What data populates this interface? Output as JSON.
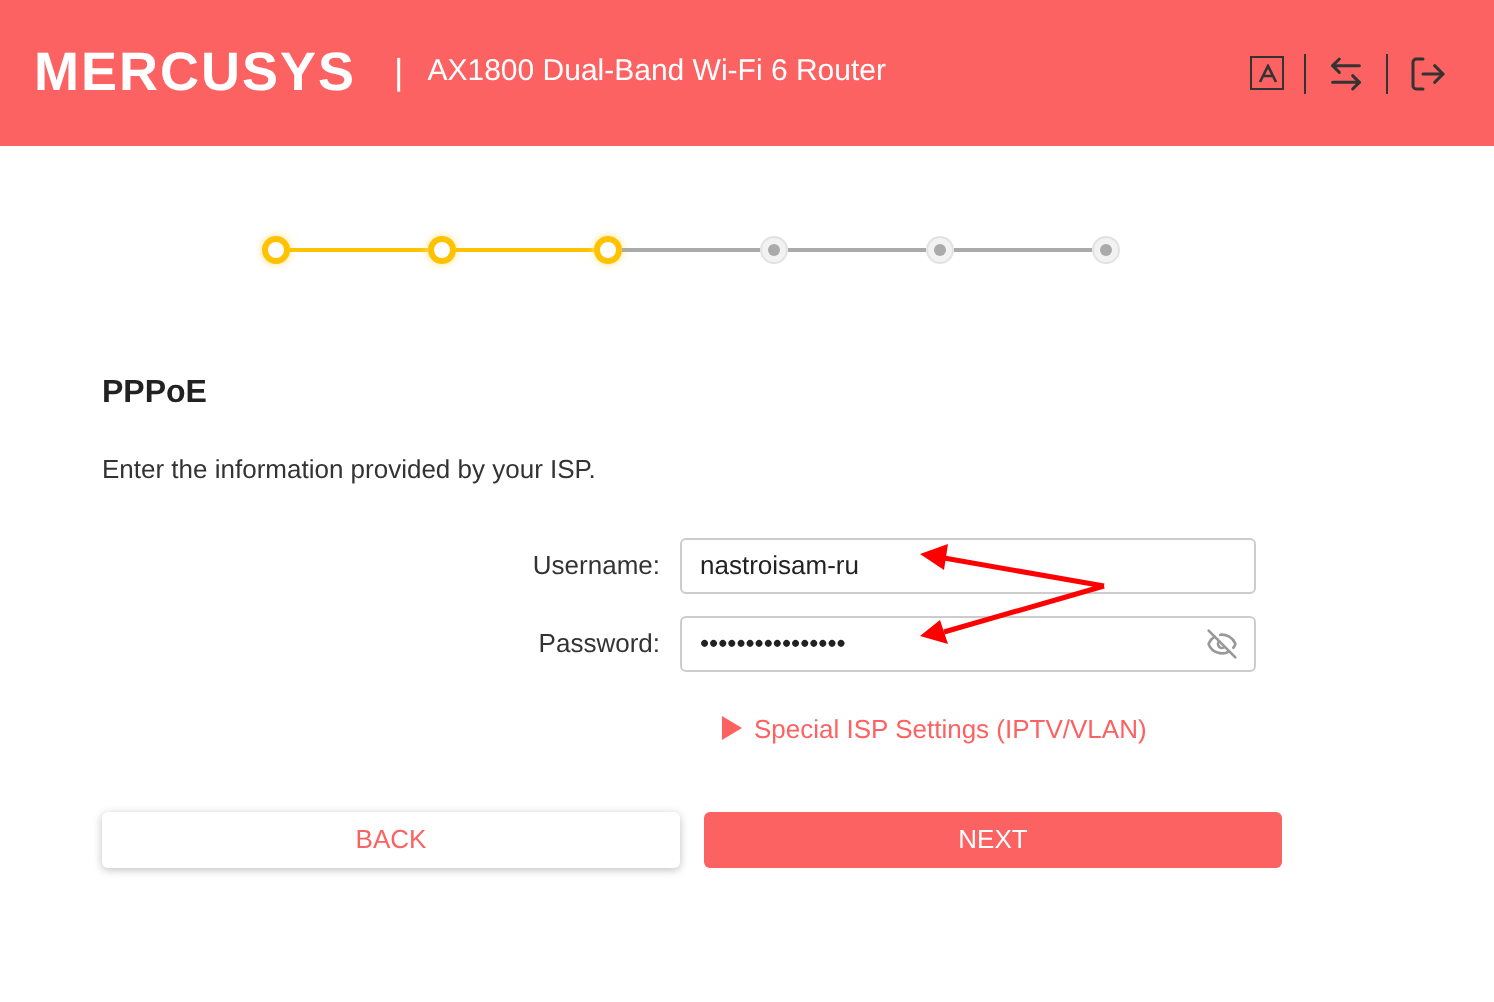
{
  "header": {
    "logo": "MERCUSYS",
    "separator": "|",
    "title": "AX1800 Dual-Band Wi-Fi 6 Router"
  },
  "steps": [
    {
      "done": true
    },
    {
      "done": true
    },
    {
      "done": true
    },
    {
      "done": false
    },
    {
      "done": false
    },
    {
      "done": false
    }
  ],
  "section": {
    "title": "PPPoE",
    "description": "Enter the information provided by your ISP."
  },
  "fields": [
    {
      "kind": "text",
      "label": "Username:",
      "value": "nastroisam-ru"
    },
    {
      "kind": "password",
      "label": "Password:",
      "value": "••••••••••••••••"
    }
  ],
  "link": {
    "label": "Special ISP Settings (IPTV/VLAN)",
    "expanded": false
  },
  "buttons": [
    {
      "kind": "secondary",
      "label": "BACK"
    },
    {
      "kind": "primary",
      "label": "NEXT"
    }
  ]
}
